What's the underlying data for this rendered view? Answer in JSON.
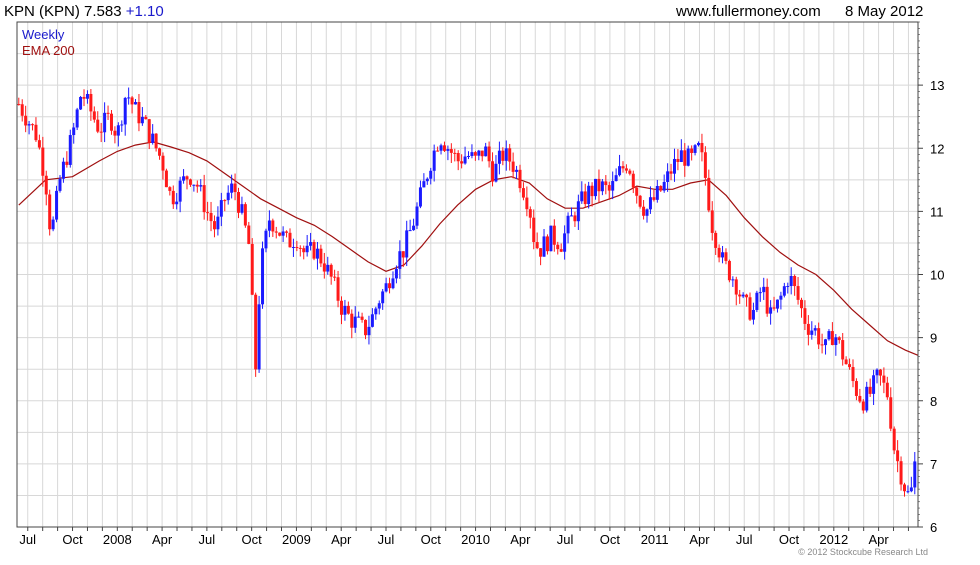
{
  "header": {
    "ticker": "KPN (KPN) 7.583",
    "change": "+1.10",
    "site": "www.fullermoney.com",
    "date": "8 May 2012"
  },
  "legend": {
    "weekly": "Weekly",
    "ema": "EMA 200"
  },
  "copyright": "© 2012 Stockcube Research Ltd",
  "colors": {
    "up": "#1a1aff",
    "down": "#ff1a1a",
    "ema": "#a01010",
    "grid": "#d8d8d8",
    "change": "#1a1acc"
  },
  "chart_data": {
    "type": "candlestick",
    "title": "KPN (KPN) 7.583 +1.10",
    "ylim": [
      6,
      14
    ],
    "yticks": [
      6,
      7,
      8,
      9,
      10,
      11,
      12,
      13
    ],
    "xlim": [
      2007.44,
      2012.47
    ],
    "xticks": [
      {
        "label": "Jul",
        "x": 2007.5
      },
      {
        "label": "Oct",
        "x": 2007.75
      },
      {
        "label": "2008",
        "x": 2008.0
      },
      {
        "label": "Apr",
        "x": 2008.25
      },
      {
        "label": "Jul",
        "x": 2008.5
      },
      {
        "label": "Oct",
        "x": 2008.75
      },
      {
        "label": "2009",
        "x": 2009.0
      },
      {
        "label": "Apr",
        "x": 2009.25
      },
      {
        "label": "Jul",
        "x": 2009.5
      },
      {
        "label": "Oct",
        "x": 2009.75
      },
      {
        "label": "2010",
        "x": 2010.0
      },
      {
        "label": "Apr",
        "x": 2010.25
      },
      {
        "label": "Jul",
        "x": 2010.5
      },
      {
        "label": "Oct",
        "x": 2010.75
      },
      {
        "label": "2011",
        "x": 2011.0
      },
      {
        "label": "Apr",
        "x": 2011.25
      },
      {
        "label": "Jul",
        "x": 2011.5
      },
      {
        "label": "Oct",
        "x": 2011.75
      },
      {
        "label": "2012",
        "x": 2012.0
      },
      {
        "label": "Apr",
        "x": 2012.25
      }
    ],
    "price_path": [
      [
        2007.45,
        12.7
      ],
      [
        2007.55,
        12.2
      ],
      [
        2007.6,
        11.5
      ],
      [
        2007.63,
        10.6
      ],
      [
        2007.68,
        11.5
      ],
      [
        2007.75,
        12.2
      ],
      [
        2007.8,
        12.9
      ],
      [
        2007.85,
        12.6
      ],
      [
        2007.9,
        12.3
      ],
      [
        2007.96,
        12.5
      ],
      [
        2008.0,
        12.2
      ],
      [
        2008.05,
        12.9
      ],
      [
        2008.1,
        12.6
      ],
      [
        2008.15,
        12.4
      ],
      [
        2008.2,
        12.1
      ],
      [
        2008.25,
        11.8
      ],
      [
        2008.3,
        11.2
      ],
      [
        2008.35,
        11.4
      ],
      [
        2008.4,
        11.6
      ],
      [
        2008.45,
        11.4
      ],
      [
        2008.5,
        11.0
      ],
      [
        2008.55,
        10.7
      ],
      [
        2008.6,
        11.2
      ],
      [
        2008.65,
        11.4
      ],
      [
        2008.7,
        10.9
      ],
      [
        2008.74,
        10.4
      ],
      [
        2008.77,
        8.4
      ],
      [
        2008.8,
        10.1
      ],
      [
        2008.85,
        10.9
      ],
      [
        2008.9,
        10.7
      ],
      [
        2008.95,
        10.5
      ],
      [
        2009.0,
        10.6
      ],
      [
        2009.05,
        10.3
      ],
      [
        2009.1,
        10.4
      ],
      [
        2009.15,
        10.2
      ],
      [
        2009.2,
        9.9
      ],
      [
        2009.25,
        9.5
      ],
      [
        2009.3,
        9.3
      ],
      [
        2009.35,
        9.2
      ],
      [
        2009.38,
        9.1
      ],
      [
        2009.42,
        9.3
      ],
      [
        2009.46,
        9.6
      ],
      [
        2009.5,
        9.8
      ],
      [
        2009.55,
        10.2
      ],
      [
        2009.6,
        10.4
      ],
      [
        2009.65,
        10.8
      ],
      [
        2009.7,
        11.3
      ],
      [
        2009.75,
        11.8
      ],
      [
        2009.8,
        12.2
      ],
      [
        2009.85,
        12.0
      ],
      [
        2009.9,
        11.8
      ],
      [
        2009.95,
        11.9
      ],
      [
        2010.0,
        11.8
      ],
      [
        2010.05,
        12.0
      ],
      [
        2010.1,
        11.6
      ],
      [
        2010.15,
        11.9
      ],
      [
        2010.2,
        11.8
      ],
      [
        2010.25,
        11.5
      ],
      [
        2010.3,
        11.1
      ],
      [
        2010.33,
        10.5
      ],
      [
        2010.36,
        10.4
      ],
      [
        2010.42,
        10.6
      ],
      [
        2010.48,
        10.5
      ],
      [
        2010.52,
        10.8
      ],
      [
        2010.58,
        11.1
      ],
      [
        2010.63,
        11.3
      ],
      [
        2010.7,
        11.4
      ],
      [
        2010.75,
        11.3
      ],
      [
        2010.8,
        11.6
      ],
      [
        2010.85,
        11.8
      ],
      [
        2010.9,
        11.3
      ],
      [
        2010.95,
        11.0
      ],
      [
        2011.0,
        11.2
      ],
      [
        2011.05,
        11.4
      ],
      [
        2011.1,
        11.7
      ],
      [
        2011.15,
        11.9
      ],
      [
        2011.2,
        11.8
      ],
      [
        2011.25,
        12.0
      ],
      [
        2011.28,
        11.6
      ],
      [
        2011.32,
        10.8
      ],
      [
        2011.38,
        10.2
      ],
      [
        2011.45,
        9.9
      ],
      [
        2011.5,
        9.5
      ],
      [
        2011.55,
        9.4
      ],
      [
        2011.6,
        9.8
      ],
      [
        2011.65,
        9.3
      ],
      [
        2011.7,
        9.6
      ],
      [
        2011.75,
        10.0
      ],
      [
        2011.8,
        9.6
      ],
      [
        2011.85,
        9.2
      ],
      [
        2011.9,
        9.1
      ],
      [
        2011.95,
        8.8
      ],
      [
        2012.0,
        9.1
      ],
      [
        2012.04,
        8.8
      ],
      [
        2012.08,
        8.5
      ],
      [
        2012.12,
        8.2
      ],
      [
        2012.16,
        8.0
      ],
      [
        2012.2,
        8.1
      ],
      [
        2012.25,
        8.4
      ],
      [
        2012.3,
        8.1
      ],
      [
        2012.34,
        7.2
      ],
      [
        2012.38,
        6.8
      ],
      [
        2012.41,
        6.5
      ],
      [
        2012.44,
        6.6
      ],
      [
        2012.47,
        7.58
      ]
    ],
    "series": [
      {
        "name": "EMA 200",
        "points": [
          [
            2007.45,
            11.1
          ],
          [
            2007.6,
            11.5
          ],
          [
            2007.75,
            11.55
          ],
          [
            2007.9,
            11.8
          ],
          [
            2008.0,
            11.95
          ],
          [
            2008.1,
            12.05
          ],
          [
            2008.2,
            12.1
          ],
          [
            2008.3,
            12.02
          ],
          [
            2008.4,
            11.93
          ],
          [
            2008.5,
            11.8
          ],
          [
            2008.6,
            11.6
          ],
          [
            2008.7,
            11.4
          ],
          [
            2008.8,
            11.2
          ],
          [
            2008.9,
            11.05
          ],
          [
            2009.0,
            10.9
          ],
          [
            2009.1,
            10.78
          ],
          [
            2009.2,
            10.6
          ],
          [
            2009.3,
            10.4
          ],
          [
            2009.4,
            10.2
          ],
          [
            2009.5,
            10.05
          ],
          [
            2009.6,
            10.15
          ],
          [
            2009.7,
            10.45
          ],
          [
            2009.8,
            10.8
          ],
          [
            2009.9,
            11.1
          ],
          [
            2010.0,
            11.35
          ],
          [
            2010.1,
            11.5
          ],
          [
            2010.2,
            11.55
          ],
          [
            2010.3,
            11.45
          ],
          [
            2010.4,
            11.2
          ],
          [
            2010.5,
            11.05
          ],
          [
            2010.6,
            11.05
          ],
          [
            2010.7,
            11.15
          ],
          [
            2010.8,
            11.25
          ],
          [
            2010.9,
            11.4
          ],
          [
            2011.0,
            11.35
          ],
          [
            2011.1,
            11.35
          ],
          [
            2011.2,
            11.45
          ],
          [
            2011.3,
            11.5
          ],
          [
            2011.4,
            11.25
          ],
          [
            2011.5,
            10.9
          ],
          [
            2011.6,
            10.6
          ],
          [
            2011.7,
            10.35
          ],
          [
            2011.8,
            10.15
          ],
          [
            2011.9,
            10.0
          ],
          [
            2012.0,
            9.75
          ],
          [
            2012.1,
            9.45
          ],
          [
            2012.2,
            9.2
          ],
          [
            2012.3,
            8.95
          ],
          [
            2012.4,
            8.8
          ],
          [
            2012.47,
            8.72
          ]
        ]
      }
    ],
    "ylabel": "",
    "xlabel": "",
    "grid": true,
    "legend_position": "top-left"
  }
}
